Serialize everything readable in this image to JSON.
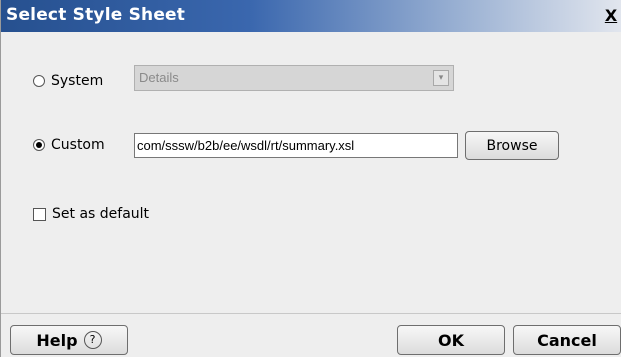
{
  "window": {
    "title": "Select Style Sheet",
    "close_glyph": "X"
  },
  "system_option": {
    "label": "System",
    "selected": false,
    "combo_value": "Details",
    "combo_arrow": "▾",
    "enabled": false
  },
  "custom_option": {
    "label": "Custom",
    "selected": true,
    "path_value": "com/sssw/b2b/ee/wsdl/rt/summary.xsl",
    "browse_label": "Browse"
  },
  "default_option": {
    "label": "Set as default",
    "checked": false
  },
  "buttons": {
    "help_label": "Help",
    "help_icon": "question-circle-icon",
    "help_glyph": "?",
    "ok_label": "OK",
    "cancel_label": "Cancel"
  }
}
